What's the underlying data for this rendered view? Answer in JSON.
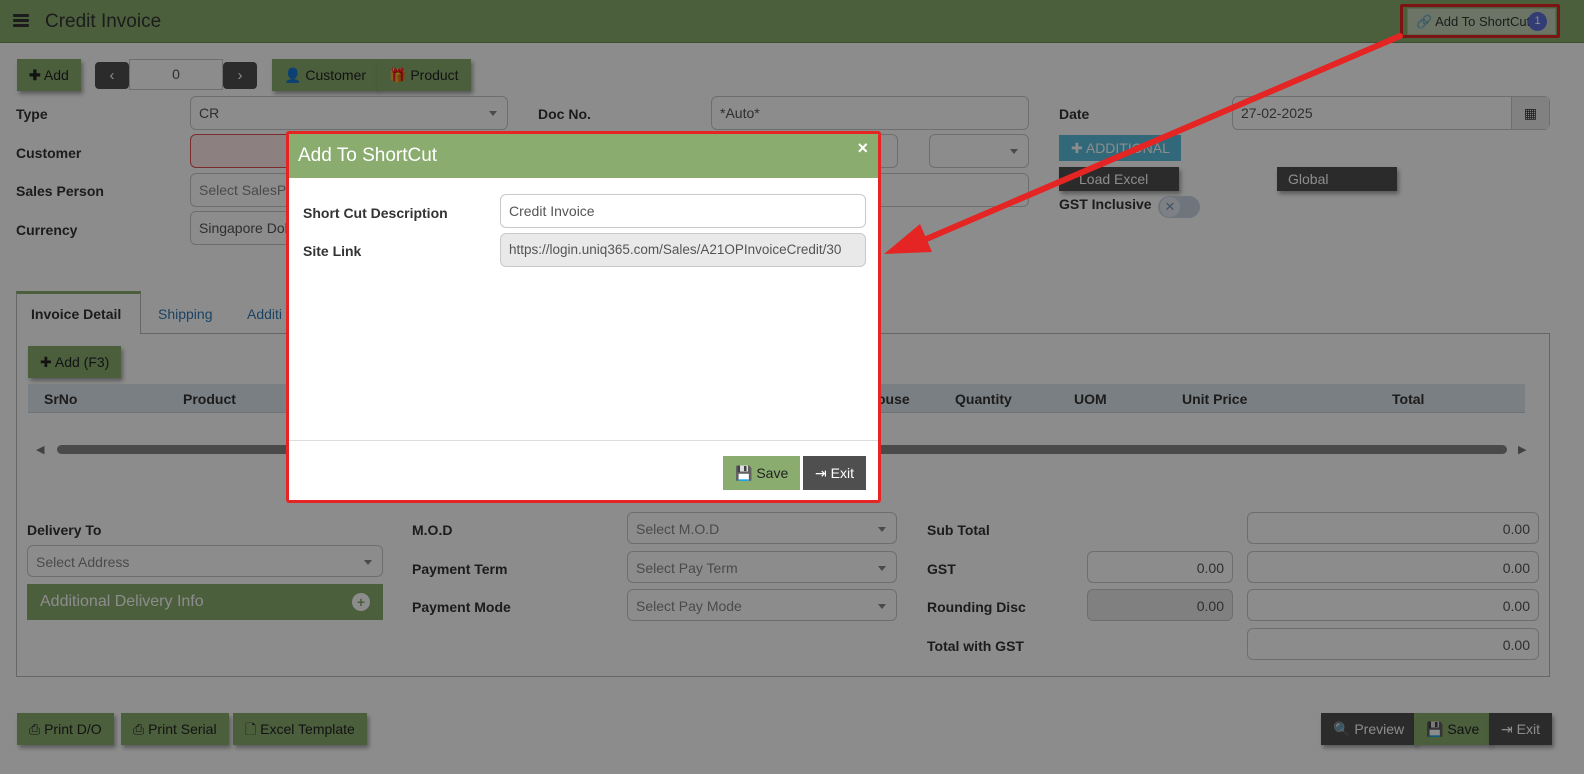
{
  "header": {
    "title": "Credit Invoice",
    "shortcut_label": "Add To ShortCut",
    "shortcut_badge": "1"
  },
  "toolbar": {
    "add": "Add",
    "record_no": "0",
    "customer": "Customer",
    "product": "Product"
  },
  "form": {
    "type_label": "Type",
    "type_value": "CR",
    "docno_label": "Doc No.",
    "docno_value": "*Auto*",
    "date_label": "Date",
    "date_value": "27-02-2025",
    "customer_label": "Customer",
    "additional_btn": "ADDITIONAL",
    "sales_label": "Sales Person",
    "sales_placeholder": "Select SalesPer",
    "load_excel": "Load Excel",
    "global_changes": "Global Changes",
    "gst_inclusive": "GST Inclusive",
    "currency_label": "Currency",
    "currency_value": "Singapore Dol"
  },
  "tabs": [
    "Invoice Detail",
    "Shipping",
    "Additi"
  ],
  "grid": {
    "add_btn": "Add (F3)",
    "columns": [
      "SrNo",
      "Product",
      "ouse",
      "Quantity",
      "UOM",
      "Unit Price",
      "Total"
    ]
  },
  "bottom": {
    "delivery_label": "Delivery To",
    "delivery_placeholder": "Select Address",
    "additional_delivery": "Additional Delivery Info",
    "mod_label": "M.O.D",
    "mod_placeholder": "Select M.O.D",
    "payterm_label": "Payment Term",
    "payterm_placeholder": "Select Pay Term",
    "paymode_label": "Payment Mode",
    "paymode_placeholder": "Select Pay Mode",
    "subtotal_label": "Sub Total",
    "subtotal": "0.00",
    "gst_label": "GST",
    "gst_rate": "0.00",
    "gst": "0.00",
    "rounding_label": "Rounding Disc",
    "rounding_rate": "0.00",
    "rounding": "0.00",
    "total_label": "Total with GST",
    "total": "0.00"
  },
  "footer": {
    "print_do": "Print D/O",
    "print_serial": "Print Serial",
    "excel_template": "Excel Template",
    "preview": "Preview",
    "save": "Save",
    "exit": "Exit"
  },
  "modal": {
    "title": "Add To ShortCut",
    "desc_label": "Short Cut Description",
    "desc_value": "Credit Invoice",
    "link_label": "Site Link",
    "link_value": "https://login.uniq365.com/Sales/A21OPInvoiceCredit/30",
    "save": "Save",
    "exit": "Exit",
    "close": "×"
  },
  "colors": {
    "accent_green": "#8aad6f",
    "highlight_red": "#e52424",
    "dark_button": "#4f4f4f"
  }
}
